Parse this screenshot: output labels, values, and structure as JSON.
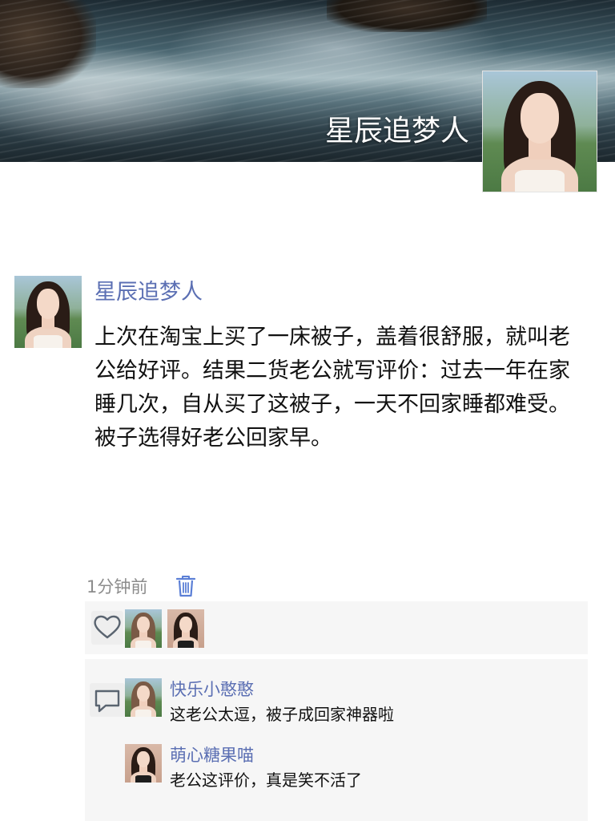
{
  "cover": {
    "title": "星辰追梦人",
    "background_image": "waterfall-rapids-photo",
    "avatar": "woman-portrait-photo"
  },
  "post": {
    "author": "星辰追梦人",
    "avatar": "woman-portrait-photo",
    "content": "上次在淘宝上买了一床被子，盖着很舒服，就叫老公给好评。结果二货老公就写评价：过去一年在家睡几次，自从买了这被子，一天不回家睡都难受。被子选得好老公回家早。",
    "time": "1分钟前",
    "delete_icon": "trash-icon"
  },
  "likes": {
    "icon": "heart-icon",
    "avatars": [
      "woman-portrait-photo",
      "woman-portrait-photo"
    ]
  },
  "comments": {
    "icon": "comment-bubble-icon",
    "items": [
      {
        "author": "快乐小憨憨",
        "text": "这老公太逗，被子成回家神器啦",
        "avatar": "woman-portrait-photo"
      },
      {
        "author": "萌心糖果喵",
        "text": "老公这评价，真是笑不活了",
        "avatar": "woman-portrait-photo"
      }
    ]
  },
  "colors": {
    "accent_name": "#5b6fb3",
    "panel_bg": "#f6f6f6",
    "muted_text": "#8c8c8c"
  }
}
